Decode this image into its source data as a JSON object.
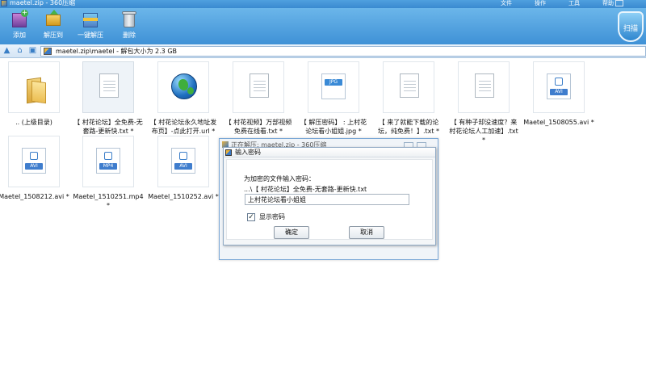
{
  "window": {
    "title": "maetel.zip - 360压缩",
    "menus": [
      "文件",
      "操作",
      "工具",
      "帮助"
    ]
  },
  "toolbar": {
    "items": [
      {
        "label": "添加",
        "icon": "add-archive-icon"
      },
      {
        "label": "解压到",
        "icon": "extract-to-icon"
      },
      {
        "label": "一键解压",
        "icon": "one-click-extract-icon"
      },
      {
        "label": "删除",
        "icon": "trash-icon"
      }
    ],
    "logo_text": "扫描"
  },
  "addressbar": {
    "path": "maetel.zip\\maetel - 解包大小为 2.3 GB"
  },
  "files": [
    {
      "name": ".. (上级目录)",
      "icon": "folder-icon"
    },
    {
      "name": "【 村花论坛】全免费-无\n套路-更新快.txt *",
      "icon": "text-file-icon"
    },
    {
      "name": "【 村花论坛永久地址发\n布页】-点此打开.url *",
      "icon": "globe-icon"
    },
    {
      "name": "【 村花视频】万部视频\n免费在线看.txt *",
      "icon": "text-file-icon"
    },
    {
      "name": "【 解压密码】 : 上村花\n论坛看小姐姐.jpg *",
      "icon": "jpg-file-icon",
      "tag": "JPG"
    },
    {
      "name": "【 来了就能下载的论\n坛，纯免费！】.txt *",
      "icon": "text-file-icon"
    },
    {
      "name": "【 有种子却没速度？来\n村花论坛人工加速】.txt *",
      "icon": "text-file-icon"
    },
    {
      "name": "Maetel_1508055.avi *",
      "icon": "video-file-icon",
      "tag": "AVI"
    },
    {
      "name": "Maetel_1508212.avi *",
      "icon": "video-file-icon",
      "tag": "AVI"
    },
    {
      "name": "Maetel_1510251.mp4 *",
      "icon": "video-file-icon",
      "tag": "MP4"
    },
    {
      "name": "Maetel_1510252.avi *",
      "icon": "video-file-icon",
      "tag": "AVI"
    }
  ],
  "progress_window": {
    "title": "正在解压: maetel.zip - 360压缩"
  },
  "password_dialog": {
    "title": "输入密码",
    "prompt": "为加密的文件输入密码：",
    "file": "...\\【 村花论坛】全免费-无套路-更新快.txt",
    "password_value": "上村花论坛看小姐姐",
    "show_password_label": "显示密码",
    "show_password_checked": "✓",
    "ok_label": "确定",
    "cancel_label": "取消"
  },
  "colors": {
    "toolbar_top": "#6bb6ea",
    "toolbar_bottom": "#3f91d6",
    "accent": "#3a8ad0"
  }
}
